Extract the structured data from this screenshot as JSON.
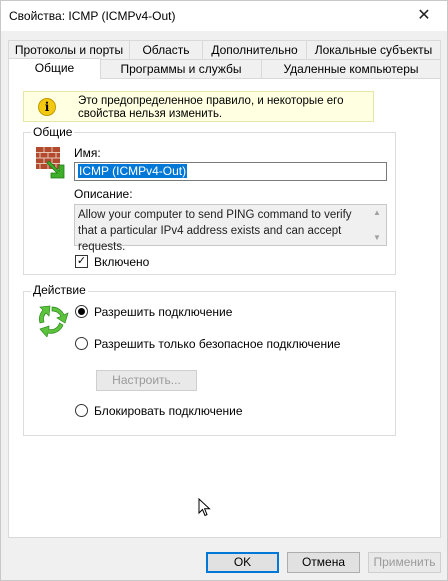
{
  "window": {
    "title": "Свойства: ICMP (ICMPv4-Out)",
    "close_glyph": "✕"
  },
  "tabs_row1": [
    {
      "label": "Протоколы и порты"
    },
    {
      "label": "Область"
    },
    {
      "label": "Дополнительно"
    },
    {
      "label": "Локальные субъекты"
    }
  ],
  "tabs_row2": [
    {
      "label": "Общие",
      "active": true
    },
    {
      "label": "Программы и службы"
    },
    {
      "label": "Удаленные компьютеры"
    }
  ],
  "info": {
    "icon": "info-icon",
    "icon_glyph": "i",
    "text": "Это предопределенное правило, и некоторые его свойства нельзя изменить."
  },
  "general": {
    "legend": "Общие",
    "name_label": "Имя:",
    "name_value": "ICMP (ICMPv4-Out)",
    "description_label": "Описание:",
    "description_text": "Allow your computer to send PING command to verify that a particular IPv4 address exists and can accept requests.",
    "enabled_label": "Включено",
    "enabled_mark": "✓",
    "scroll_up": "▲",
    "scroll_down": "▼",
    "icon": "firewall-rule-icon"
  },
  "action": {
    "legend": "Действие",
    "icon": "refresh-arrows-icon",
    "options": [
      {
        "label": "Разрешить подключение",
        "checked": true
      },
      {
        "label": "Разрешить только безопасное подключение",
        "checked": false
      },
      {
        "label": "Блокировать подключение",
        "checked": false
      }
    ],
    "configure_label": "Настроить..."
  },
  "buttons": {
    "ok": "OK",
    "cancel": "Отмена",
    "apply": "Применить"
  },
  "colors": {
    "accent": "#0078d7",
    "info_bg": "#ffffe1",
    "panel_bg": "#ffffff",
    "window_bg": "#f0f0f0"
  }
}
